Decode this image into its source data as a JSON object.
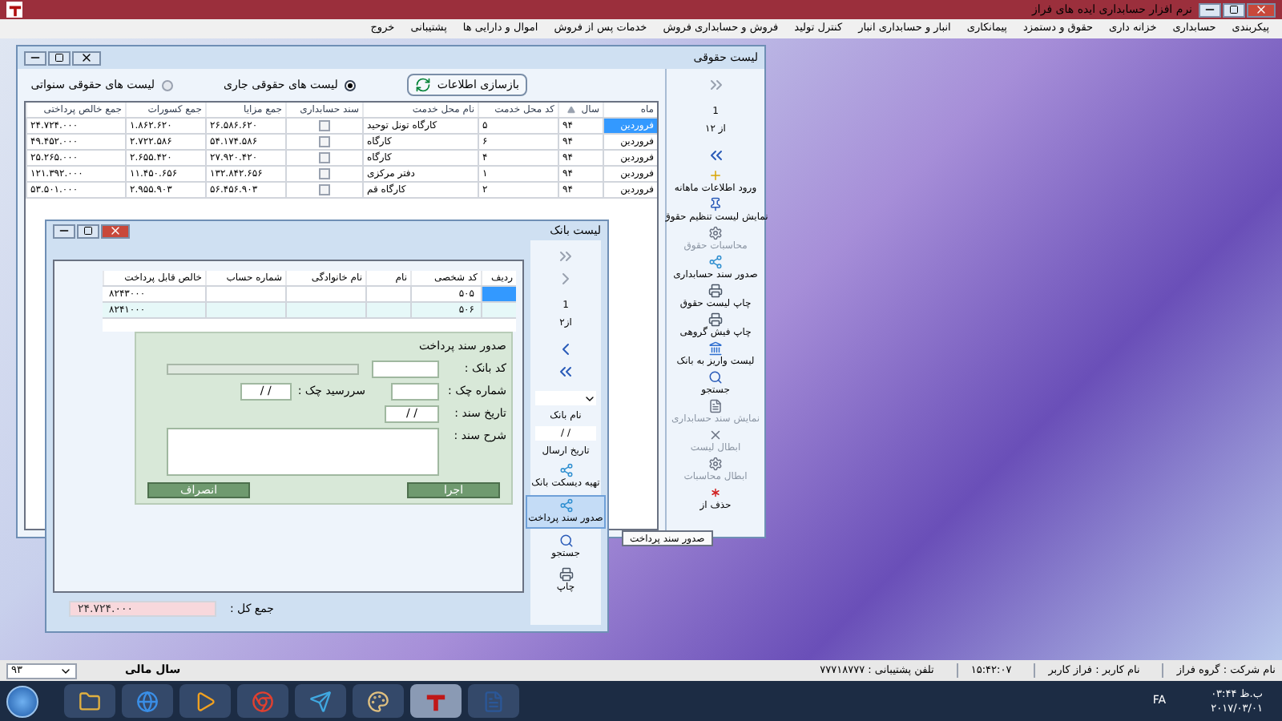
{
  "app": {
    "title": "نرم افزار حسابداری ایده های فراز"
  },
  "menu": [
    "پیکربندی",
    "حسابداری",
    "خزانه داری",
    "حقوق و دستمزد",
    "پیمانکاری",
    "انبار و حسابداری انبار",
    "کنترل تولید",
    "فروش و حسابداری فروش",
    "خدمات پس از فروش",
    "اموال و دارایی ها",
    "پشتیبانی",
    "خروج"
  ],
  "salary_window": {
    "title": "لیست حقوقی",
    "refresh_button": "بازسازی اطلاعات",
    "list_types": [
      {
        "label": "لیست های حقوقی جاری",
        "selected": true
      },
      {
        "label": "لیست های حقوقی سنواتی",
        "selected": false
      }
    ],
    "columns": [
      "ماه",
      "سال",
      "کد محل خدمت",
      "نام محل خدمت",
      "سند حسابداری",
      "جمع مزایا",
      "جمع کسورات",
      "جمع خالص پرداختی"
    ],
    "rows": [
      {
        "month": "فروردین",
        "year": "۹۴",
        "site_code": "۵",
        "site_name": "کارگاه تونل توحید",
        "voucher": false,
        "benefits": "۲۶.۵۸۶.۶۲۰",
        "deductions": "۱.۸۶۲.۶۲۰",
        "net": "۲۴.۷۲۴.۰۰۰",
        "selected": true
      },
      {
        "month": "فروردین",
        "year": "۹۴",
        "site_code": "۶",
        "site_name": "کارگاه",
        "voucher": false,
        "benefits": "۵۴.۱۷۴.۵۸۶",
        "deductions": "۲.۷۲۲.۵۸۶",
        "net": "۴۹.۴۵۲.۰۰۰",
        "selected": false
      },
      {
        "month": "فروردین",
        "year": "۹۴",
        "site_code": "۴",
        "site_name": "کارگاه",
        "voucher": false,
        "benefits": "۲۷.۹۲۰.۴۲۰",
        "deductions": "۲.۶۵۵.۴۲۰",
        "net": "۲۵.۲۶۵.۰۰۰",
        "selected": false
      },
      {
        "month": "فروردین",
        "year": "۹۴",
        "site_code": "۱",
        "site_name": "دفتر مرکزی",
        "voucher": false,
        "benefits": "۱۳۲.۸۴۲.۶۵۶",
        "deductions": "۱۱.۴۵۰.۶۵۶",
        "net": "۱۲۱.۳۹۲.۰۰۰",
        "selected": false
      },
      {
        "month": "فروردین",
        "year": "۹۴",
        "site_code": "۲",
        "site_name": "کارگاه قم",
        "voucher": false,
        "benefits": "۵۶.۴۵۶.۹۰۳",
        "deductions": "۲.۹۵۵.۹۰۳",
        "net": "۵۳.۵۰۱.۰۰۰",
        "selected": false
      }
    ],
    "pager": {
      "current": "1",
      "total": "از ۱۲"
    },
    "actions": [
      {
        "label": "ورود اطلاعات ماهانه",
        "disabled": false
      },
      {
        "label": "نمایش لیست تنظیم حقوق",
        "disabled": false
      },
      {
        "label": "محاسبات حقوق",
        "disabled": true
      },
      {
        "label": "صدور سند حسابداری",
        "disabled": false
      },
      {
        "label": "چاپ لیست حقوق",
        "disabled": false
      },
      {
        "label": "چاپ فیش گروهی",
        "disabled": false
      },
      {
        "label": "لیست واریز به بانک",
        "disabled": false
      },
      {
        "label": "جستجو",
        "disabled": false
      },
      {
        "label": "نمایش سند حسابداری",
        "disabled": true
      },
      {
        "label": "ابطال لیست",
        "disabled": true
      },
      {
        "label": "ابطال محاسبات",
        "disabled": true
      },
      {
        "label": "حذف از",
        "disabled": false
      }
    ]
  },
  "bank_window": {
    "title": "لیست بانک",
    "columns": [
      "ردیف",
      "کد شخصی",
      "نام",
      "نام خانوادگی",
      "شماره حساب",
      "خالص قابل پرداخت"
    ],
    "rows": [
      {
        "code": "۵۰۵",
        "net": "۸۲۴۳۰۰۰",
        "selected": true
      },
      {
        "code": "۵۰۶",
        "net": "۸۲۴۱۰۰۰",
        "selected": false
      }
    ],
    "pager": {
      "current": "1",
      "total": "از۲"
    },
    "bank_name_label": "نام بانک",
    "send_date": "/ /",
    "send_date_label": "تاریخ ارسال",
    "actions": [
      {
        "label": "تهیه دیسکت بانک",
        "selected": false
      },
      {
        "label": "صدور سند پرداخت",
        "selected": true
      },
      {
        "label": "جستجو",
        "selected": false
      },
      {
        "label": "چاپ",
        "selected": false
      }
    ],
    "payment": {
      "title": "صدور سند پرداخت",
      "bank_code_label": "کد بانک :",
      "check_no_label": "شماره چک :",
      "due_date_label": "سررسید چک :",
      "due_date": "/ /",
      "doc_date_label": "تاریخ سند :",
      "doc_date": "/ /",
      "description_label": "شرح سند :",
      "run_button": "اجرا",
      "cancel_button": "انصراف"
    },
    "total_label": "جمع کل :",
    "total": "۲۴.۷۲۴.۰۰۰"
  },
  "tooltip": "صدور سند پرداخت",
  "status_bar": {
    "company": "نام شرکت : گروه فراز",
    "user": "نام کاربر : فراز کاربر",
    "time": "۱۵:۴۲:۰۷",
    "support_phone": "تلفن پشتیبانی : ۷۷۷۱۸۷۷۷",
    "fiscal_year_label": "سال مالی",
    "fiscal_year": "۹۳"
  },
  "taskbar": {
    "language": "FA",
    "time": "۰۳:۴۴ ب.ظ",
    "date": "۲۰۱۷/۰۳/۰۱"
  }
}
